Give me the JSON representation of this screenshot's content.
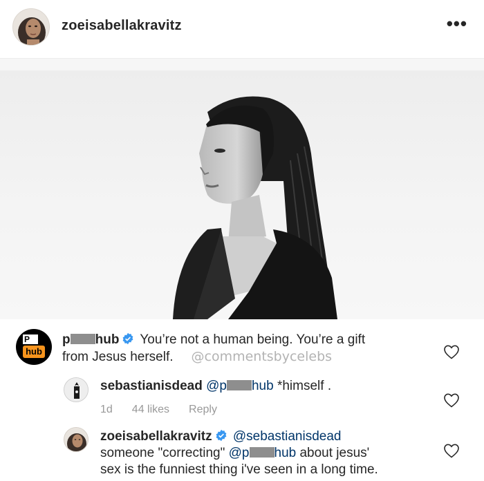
{
  "post": {
    "username": "zoeisabellakravitz",
    "more_label": "•••"
  },
  "comments": [
    {
      "username_pre": "p",
      "username_post": "hub",
      "avatar_letter": "P",
      "avatar_word": "hub",
      "text_line1": "You’re not a human being. You’re a gift",
      "text_line2": "from Jesus herself.",
      "watermark": "@commentsbycelebs"
    },
    {
      "username": "sebastianisdead",
      "mention_pre": "@p",
      "mention_post": "hub",
      "text": "*himself .",
      "time": "1d",
      "likes": "44 likes",
      "reply": "Reply"
    },
    {
      "username": "zoeisabellakravitz",
      "mention": "@sebastianisdead",
      "line2_pre": "someone \"correcting\"",
      "line2_mention_pre": "@p",
      "line2_mention_post": "hub",
      "line2_post": "about jesus'",
      "line3": "sex is the funniest thing i've seen in a long time."
    }
  ],
  "colors": {
    "text": "#262626",
    "mention": "#003569",
    "meta": "#999999",
    "verified": "#3897f0",
    "brand_orange": "#f7941d"
  },
  "icons": [
    "more-options-icon",
    "verified-badge-icon",
    "heart-icon"
  ]
}
